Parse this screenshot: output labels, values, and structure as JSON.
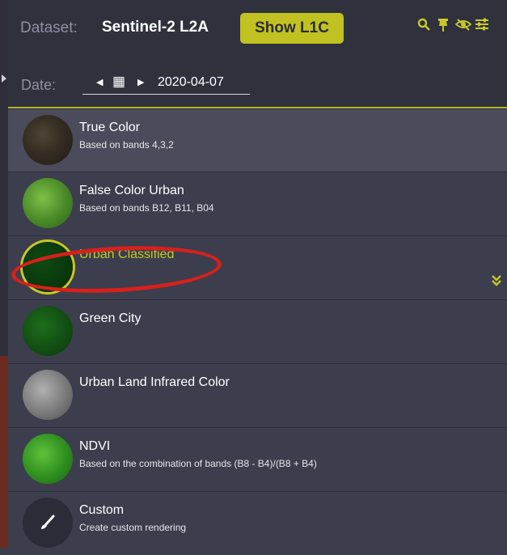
{
  "header": {
    "dataset_label": "Dataset:",
    "dataset_value": "Sentinel-2 L2A",
    "show_button": "Show L1C",
    "date_label": "Date:",
    "date_value": "2020-04-07",
    "tools": [
      "search-icon",
      "pin-icon",
      "eye-slash-icon",
      "sliders-icon"
    ]
  },
  "layers": [
    {
      "title": "True Color",
      "desc": "Based on bands 4,3,2"
    },
    {
      "title": "False Color Urban",
      "desc": "Based on bands B12, B11, B04"
    },
    {
      "title": "Urban Classified",
      "desc": ""
    },
    {
      "title": "Green City",
      "desc": ""
    },
    {
      "title": "Urban Land Infrared Color",
      "desc": ""
    },
    {
      "title": "NDVI",
      "desc": "Based on the combination of bands (B8 - B4)/(B8 + B4)"
    },
    {
      "title": "Custom",
      "desc": "Create custom rendering"
    }
  ],
  "colors": {
    "accent": "#c8c826",
    "annotation": "#d7201c"
  }
}
